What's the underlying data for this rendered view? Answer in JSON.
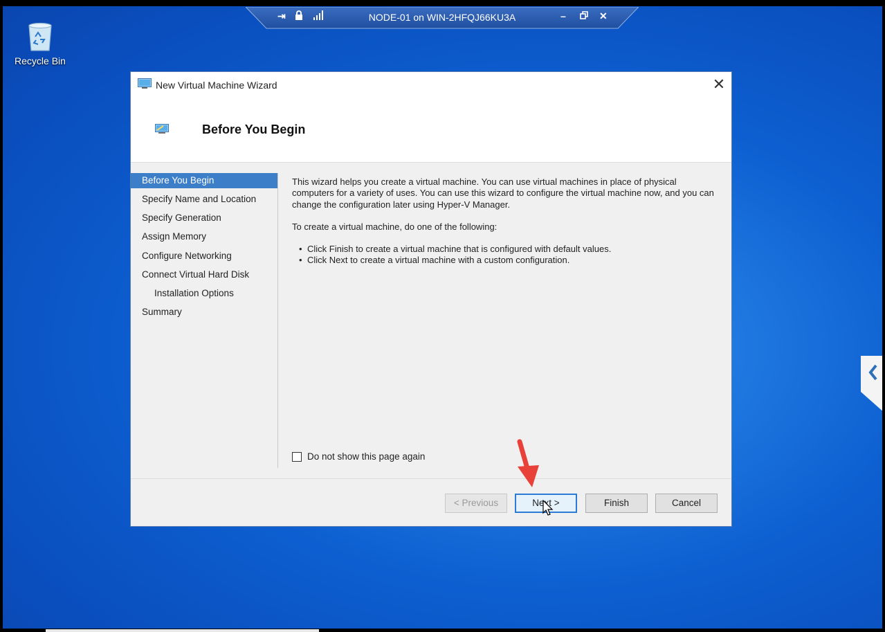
{
  "desktop": {
    "recycle_bin_label": "Recycle Bin"
  },
  "rdp_bar": {
    "title": "NODE-01 on WIN-2HFQJ66KU3A",
    "icons": [
      "pin-icon",
      "lock-icon",
      "signal-icon",
      "minimize-icon",
      "restore-icon",
      "close-icon"
    ]
  },
  "dialog": {
    "window_title": "New Virtual Machine Wizard",
    "page_title": "Before You Begin",
    "close_symbol": "✕",
    "nav_items": [
      {
        "label": "Before You Begin",
        "selected": true
      },
      {
        "label": "Specify Name and Location"
      },
      {
        "label": "Specify Generation"
      },
      {
        "label": "Assign Memory"
      },
      {
        "label": "Configure Networking"
      },
      {
        "label": "Connect Virtual Hard Disk"
      },
      {
        "label": "Installation Options"
      },
      {
        "label": "Summary"
      }
    ],
    "intro_text": "This wizard helps you create a virtual machine. You can use virtual machines in place of physical computers for a variety of uses. You can use this wizard to configure the virtual machine now, and you can change the configuration later using Hyper-V Manager.",
    "instruction_text": "To create a virtual machine, do one of the following:",
    "bullets": [
      "Click Finish to create a virtual machine that is configured with default values.",
      "Click Next to create a virtual machine with a custom configuration."
    ],
    "checkbox_label": "Do not show this page again",
    "checkbox_checked": false,
    "buttons": {
      "previous": "< Previous",
      "next": "Next >",
      "finish": "Finish",
      "cancel": "Cancel"
    }
  },
  "colors": {
    "selection": "#3c7ec8",
    "annotation_arrow": "#e8413a"
  }
}
